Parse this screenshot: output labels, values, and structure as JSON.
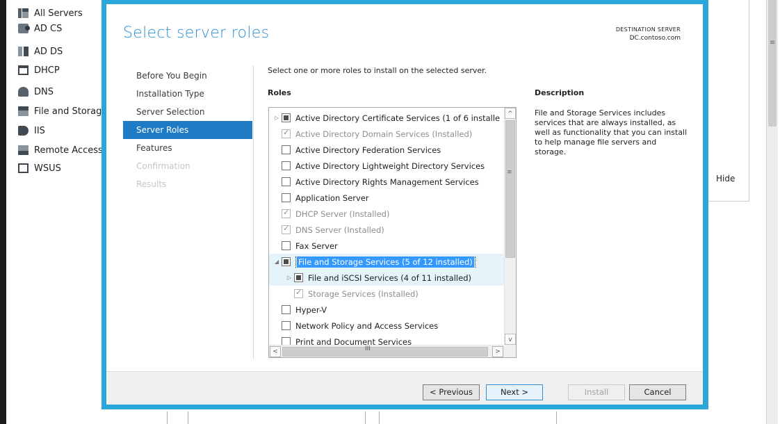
{
  "background": {
    "sidebar_items": [
      {
        "label": "All Servers",
        "icon": "all-servers-icon"
      },
      {
        "label": "AD CS",
        "icon": "ad-cs-icon"
      },
      {
        "label": "AD DS",
        "icon": "ad-ds-icon"
      },
      {
        "label": "DHCP",
        "icon": "dhcp-icon"
      },
      {
        "label": "DNS",
        "icon": "dns-icon"
      },
      {
        "label": "File and Storag",
        "icon": "file-storage-icon"
      },
      {
        "label": "IIS",
        "icon": "iis-icon"
      },
      {
        "label": "Remote Access",
        "icon": "remote-access-icon"
      },
      {
        "label": "WSUS",
        "icon": "wsus-icon"
      }
    ],
    "hide_label": "Hide"
  },
  "wizard": {
    "title": "Select server roles",
    "destination_label": "DESTINATION SERVER",
    "destination_server": "DC.contoso.com",
    "nav": [
      {
        "label": "Before You Begin",
        "state": "normal"
      },
      {
        "label": "Installation Type",
        "state": "normal"
      },
      {
        "label": "Server Selection",
        "state": "normal"
      },
      {
        "label": "Server Roles",
        "state": "active"
      },
      {
        "label": "Features",
        "state": "normal"
      },
      {
        "label": "Confirmation",
        "state": "disabled"
      },
      {
        "label": "Results",
        "state": "disabled"
      }
    ],
    "instruction": "Select one or more roles to install on the selected server.",
    "roles_heading": "Roles",
    "description_heading": "Description",
    "description_text": "File and Storage Services includes services that are always installed, as well as functionality that you can install to help manage file servers and storage.",
    "roles": [
      {
        "label": "Active Directory Certificate Services (1 of 6 installe",
        "level": 0,
        "expander": "▷",
        "check": "partial",
        "dim": false
      },
      {
        "label": "Active Directory Domain Services (Installed)",
        "level": 0,
        "expander": "",
        "check": "checked",
        "dim": true
      },
      {
        "label": "Active Directory Federation Services",
        "level": 0,
        "expander": "",
        "check": "none",
        "dim": false
      },
      {
        "label": "Active Directory Lightweight Directory Services",
        "level": 0,
        "expander": "",
        "check": "none",
        "dim": false
      },
      {
        "label": "Active Directory Rights Management Services",
        "level": 0,
        "expander": "",
        "check": "none",
        "dim": false
      },
      {
        "label": "Application Server",
        "level": 0,
        "expander": "",
        "check": "none",
        "dim": false
      },
      {
        "label": "DHCP Server (Installed)",
        "level": 0,
        "expander": "",
        "check": "checked",
        "dim": true
      },
      {
        "label": "DNS Server (Installed)",
        "level": 0,
        "expander": "",
        "check": "checked",
        "dim": true
      },
      {
        "label": "Fax Server",
        "level": 0,
        "expander": "",
        "check": "none",
        "dim": false
      },
      {
        "label": "File and Storage Services (5 of 12 installed)",
        "level": 0,
        "expander": "◢",
        "check": "partial",
        "dim": false,
        "selected": true
      },
      {
        "label": "File and iSCSI Services (4 of 11 installed)",
        "level": 1,
        "expander": "▷",
        "check": "partial",
        "dim": false,
        "hover": true
      },
      {
        "label": "Storage Services (Installed)",
        "level": 1,
        "expander": "",
        "check": "checked",
        "dim": true
      },
      {
        "label": "Hyper-V",
        "level": 0,
        "expander": "",
        "check": "none",
        "dim": false
      },
      {
        "label": "Network Policy and Access Services",
        "level": 0,
        "expander": "",
        "check": "none",
        "dim": false
      },
      {
        "label": "Print and Document Services",
        "level": 0,
        "expander": "",
        "check": "none",
        "dim": false
      }
    ],
    "scroll_up": "^",
    "scroll_down": "v",
    "scroll_left": "<",
    "scroll_right": ">",
    "scroll_grip": "≡",
    "hscroll_grip": "III",
    "buttons": {
      "previous": "< Previous",
      "next": "Next >",
      "install": "Install",
      "cancel": "Cancel"
    }
  }
}
